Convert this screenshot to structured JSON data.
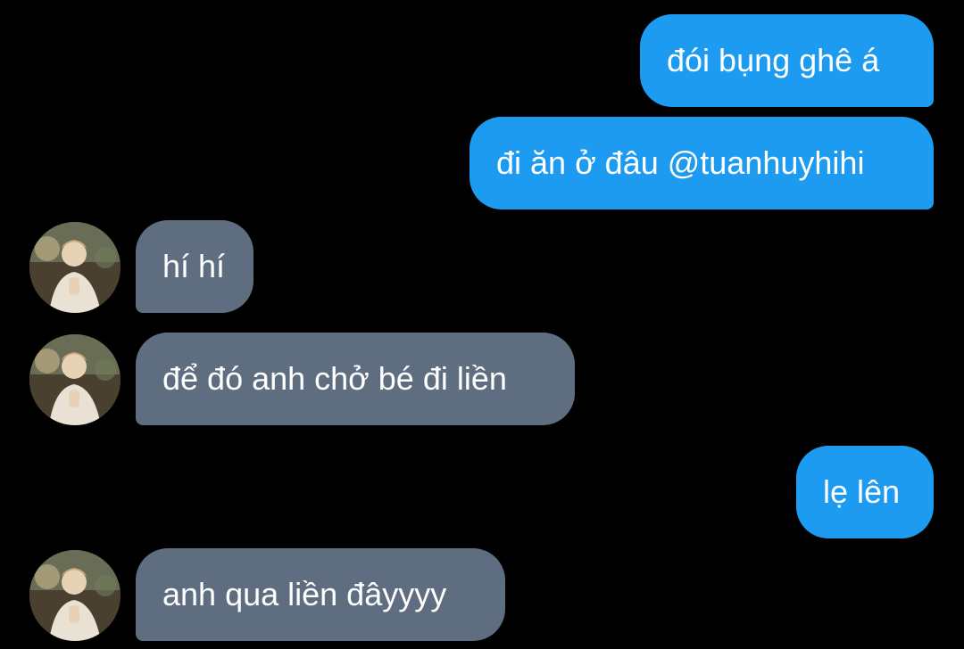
{
  "colors": {
    "background": "#000000",
    "sent_bubble": "#1d9bf0",
    "received_bubble": "#5e6e80",
    "text": "#ffffff"
  },
  "messages": [
    {
      "direction": "sent",
      "text": "đói bụng ghê á"
    },
    {
      "direction": "sent",
      "text": "đi ăn ở đâu @tuanhuyhihi"
    },
    {
      "direction": "received",
      "text": "hí hí"
    },
    {
      "direction": "received",
      "text": "để đó anh chở bé đi liền"
    },
    {
      "direction": "sent",
      "text": "lẹ lên"
    },
    {
      "direction": "received",
      "text": "anh qua liền đâyyyy"
    }
  ]
}
